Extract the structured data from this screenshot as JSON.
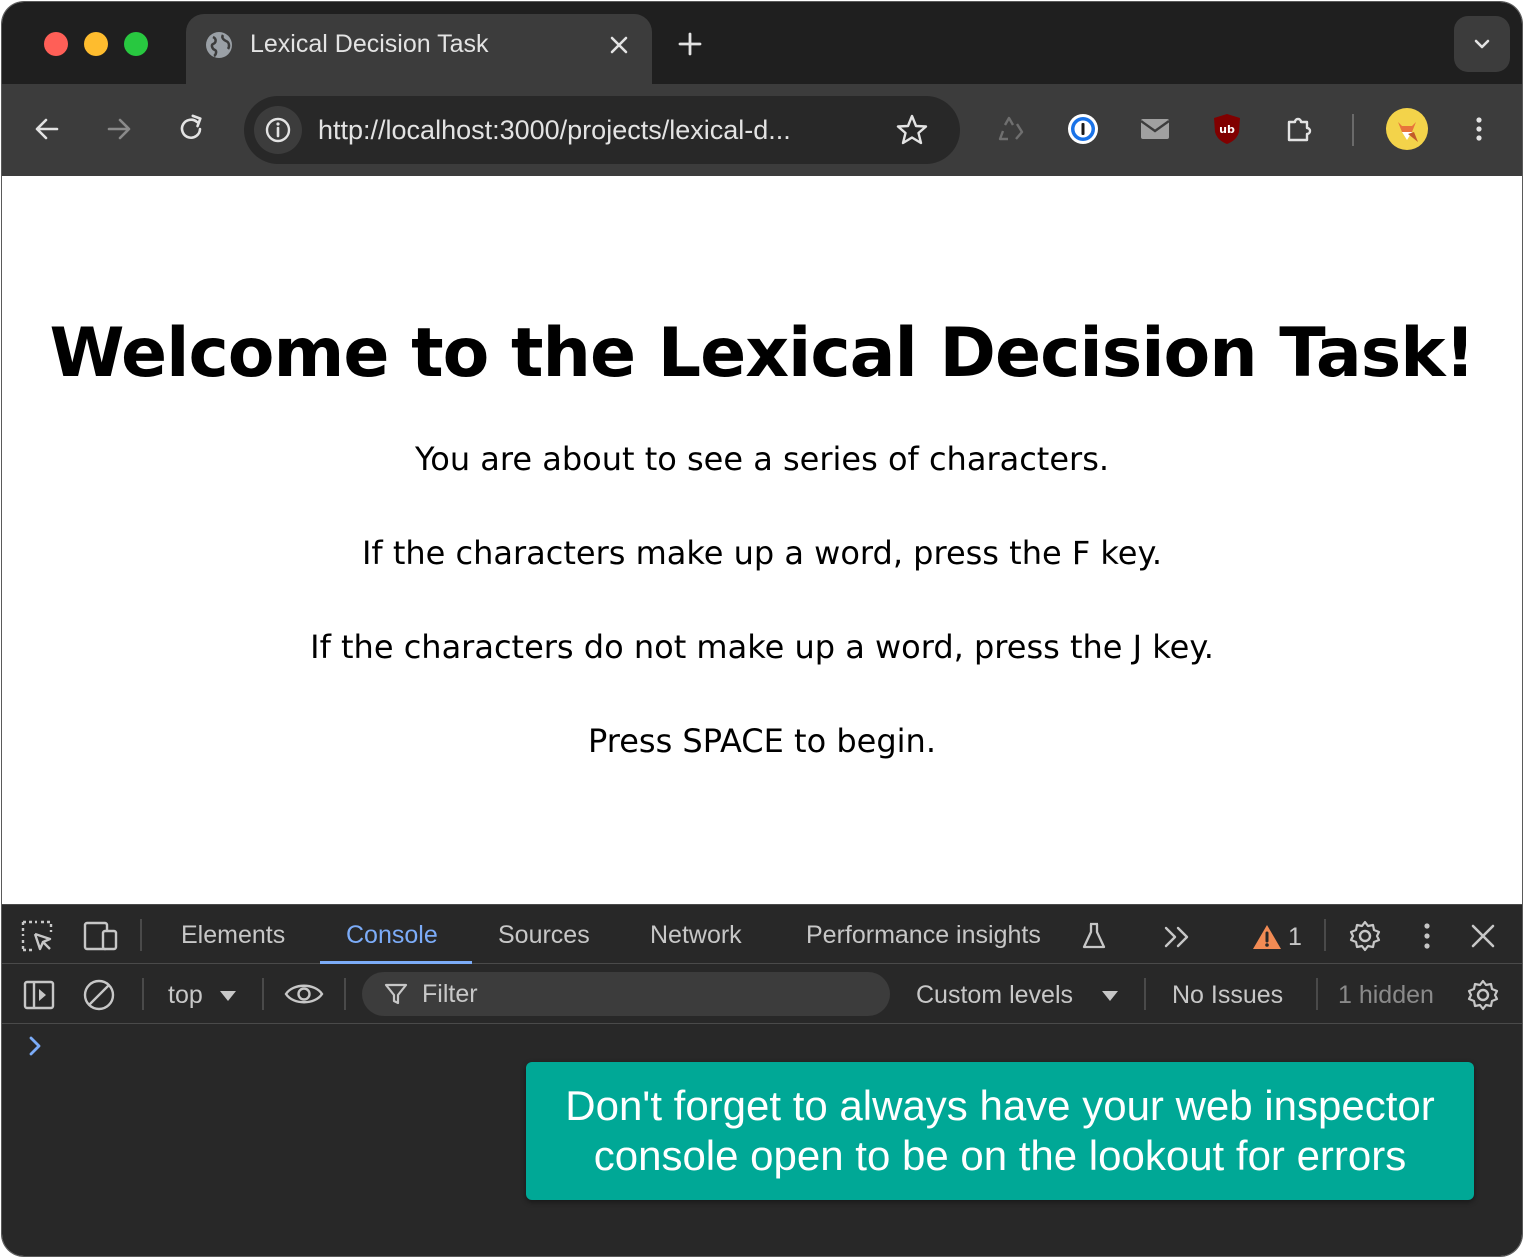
{
  "browser": {
    "tab": {
      "title": "Lexical Decision Task"
    },
    "omnibox": {
      "url": "http://localhost:3000/projects/lexical-d..."
    },
    "extensions": [
      "recycle-icon",
      "password-manager-icon",
      "mail-icon",
      "ublock-icon",
      "puzzle-icon"
    ]
  },
  "page": {
    "heading": "Welcome to the Lexical Decision Task!",
    "lines": [
      "You are about to see a series of characters.",
      "If the characters make up a word, press the F key.",
      "If the characters do not make up a word, press the J key.",
      "Press SPACE to begin."
    ]
  },
  "devtools": {
    "tabs": {
      "elements": "Elements",
      "console": "Console",
      "sources": "Sources",
      "network": "Network",
      "performance": "Performance insights"
    },
    "active_tab": "Console",
    "warning_count": "1",
    "filterbar": {
      "context": "top",
      "filter_placeholder": "Filter",
      "levels": "Custom levels",
      "issues": "No Issues",
      "hidden": "1 hidden"
    }
  },
  "callout": {
    "line1": "Don't forget to always have your web inspector",
    "line2": "console open to be on the lookout for errors"
  },
  "colors": {
    "accent_blue": "#7cacf8",
    "callout_bg": "#00a896",
    "warning": "#f28b54"
  }
}
